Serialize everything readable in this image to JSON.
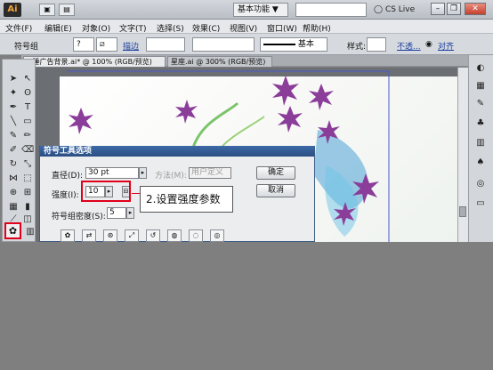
{
  "titlebar": {
    "logo": "Ai",
    "workspace": "基本功能",
    "workspace_arrow": "▼",
    "cs_live": "CS Live",
    "minimize": "–",
    "restore": "❐",
    "close": "✕"
  },
  "menu": [
    "文件(F)",
    "编辑(E)",
    "对象(O)",
    "文字(T)",
    "选择(S)",
    "效果(C)",
    "视图(V)",
    "窗口(W)",
    "帮助(H)"
  ],
  "controlbar": {
    "tool_name": "符号组",
    "stroke_label": "描边",
    "brush_label": "基本",
    "style_label": "样式:",
    "opacity_label": "不透...",
    "align_label": "对齐"
  },
  "tabs": [
    {
      "label": "* 睡广告背景.ai* @ 100% (RGB/预览)"
    },
    {
      "label": "星座.ai @ 300% (RGB/预览)"
    }
  ],
  "dialog": {
    "title": "符号工具选项",
    "diameter_label": "直径(D):",
    "diameter_value": "30 pt",
    "method_label": "方法(M):",
    "method_value": "用户定义",
    "intensity_label": "强度(I):",
    "intensity_value": "10",
    "density_label": "符号组密度(S):",
    "density_value": "5",
    "ok_label": "确定",
    "cancel_label": "取消"
  },
  "annotation": "2.设置强度参数",
  "colors": {
    "highlight": "#e0001a",
    "dialog_title": "#2a4e82",
    "flower": "#8b3d9a",
    "splash": "#4ba3d6"
  }
}
